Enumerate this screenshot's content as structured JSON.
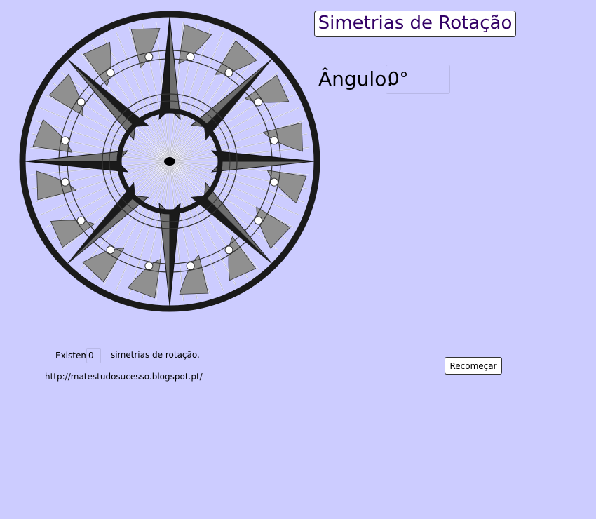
{
  "title": "Simetrias de Rotação",
  "angle": {
    "label": "Ângulo:",
    "value": "0°"
  },
  "symmetry": {
    "prefix": "Existem",
    "count": "0",
    "suffix": "simetrias de rotação."
  },
  "link": "http://matestudosucesso.blogspot.pt/",
  "restart_label": "Recomeçar",
  "colors": {
    "background": "#ccccff",
    "title_text": "#330066",
    "dark": "#1a1a1a",
    "gray": "#6e6e6e",
    "light_gray": "#909090",
    "ring_fill": "#e6e6f2"
  },
  "icons": [
    "compass-rose-icon"
  ]
}
